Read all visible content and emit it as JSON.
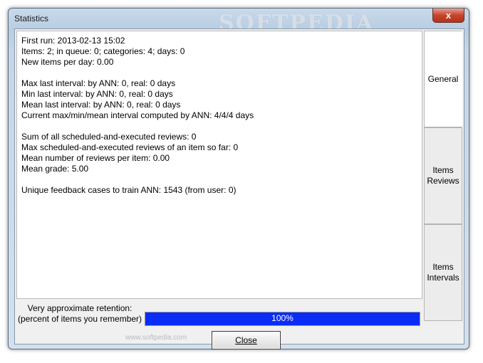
{
  "window": {
    "title": "Statistics",
    "watermark": "SOFTPEDIA",
    "close_glyph": "x"
  },
  "stats": {
    "line1": "First run: 2013-02-13 15:02",
    "line2": "Items: 2; in queue: 0; categories: 4; days: 0",
    "line3": "New items per day: 0.00",
    "line4": "Max last interval: by ANN: 0, real: 0 days",
    "line5": "Min last interval: by ANN: 0, real: 0 days",
    "line6": "Mean last interval: by ANN: 0, real: 0 days",
    "line7": "Current max/min/mean interval computed by ANN: 4/4/4 days",
    "line8": "Sum of all scheduled-and-executed reviews: 0",
    "line9": "Max scheduled-and-executed reviews of an item so far: 0",
    "line10": "Mean number of reviews per item: 0.00",
    "line11": "Mean grade: 5.00",
    "line12": "Unique feedback cases to train ANN: 1543 (from user: 0)"
  },
  "retention": {
    "label1": "Very approximate retention:",
    "label2": "(percent of items you remember)",
    "value_text": "100%",
    "value": 1.0
  },
  "footer": {
    "watermark": "www.softpedia.com",
    "close_label": "Close"
  },
  "tabs": [
    {
      "line1": "General",
      "line2": ""
    },
    {
      "line1": "Items",
      "line2": "Reviews"
    },
    {
      "line1": "Items",
      "line2": "Intervals"
    }
  ],
  "colors": {
    "progress_fill": "#0a2cf5",
    "titlebar_close": "#c8432b"
  }
}
